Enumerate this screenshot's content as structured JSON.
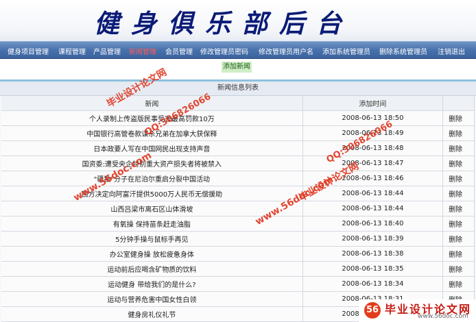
{
  "header": {
    "title": "健身俱乐部后台"
  },
  "nav": {
    "items": [
      {
        "label": "健身项目管理"
      },
      {
        "label": "课程管理"
      },
      {
        "label": "产品管理"
      },
      {
        "label": "新闻管理"
      },
      {
        "label": "会员管理"
      },
      {
        "label": "修改管理员密码"
      },
      {
        "label": "修改管理员用户名"
      },
      {
        "label": "添加系统管理员"
      },
      {
        "label": "删除系统管理员"
      },
      {
        "label": "注销退出"
      }
    ]
  },
  "actions": {
    "add_news": "添加新闻"
  },
  "table": {
    "caption": "新闻信息列表",
    "headers": {
      "title": "新闻",
      "time": "添加时间",
      "op": ""
    },
    "rows": [
      {
        "title": "个人录制上传盗版民事受害最高罚款10万",
        "time": "2008-06-13 18:50",
        "action": "删除"
      },
      {
        "title": "中国银行高管卷款谋杀兄弟在加拿大获保释",
        "time": "2008-06-13 18:49",
        "action": "删除"
      },
      {
        "title": "日本政要人写在中国网民出现支持声音",
        "time": "2008-06-13 18:48",
        "action": "删除"
      },
      {
        "title": "国资委:遭受央企特别重大资产损失者将被禁入",
        "time": "2008-06-13 18:47",
        "action": "删除"
      },
      {
        "title": "\"疆独\"分子在尼泊尔重启分裂中国活动",
        "time": "2008-06-13 18:46",
        "action": "删除"
      },
      {
        "title": "西方决定向阿富汗提供5000万人民币无偿援助",
        "time": "2008-06-13 18:44",
        "action": "删除"
      },
      {
        "title": "山西吕梁市离石区山体滑坡",
        "time": "2008-06-13 18:44",
        "action": "删除"
      },
      {
        "title": "有氧操 保持苗条赶走油脂",
        "time": "2008-06-13 18:40",
        "action": "删除"
      },
      {
        "title": "5分钟手操与鼠标手再见",
        "time": "2008-06-13 18:39",
        "action": "删除"
      },
      {
        "title": "办公室健身操 放松疲惫身体",
        "time": "2008-06-13 18:38",
        "action": "删除"
      },
      {
        "title": "运动前后应喝含矿物质的饮料",
        "time": "2008-06-13 18:35",
        "action": "删除"
      },
      {
        "title": "运动健身 带给我们的是什么?",
        "time": "2008-06-13 18:34",
        "action": "删除"
      },
      {
        "title": "运动与营养危害中国女性白领",
        "time": "2008-06-13 18:31",
        "action": "删除"
      },
      {
        "title": "健身房礼仪礼节",
        "time": "2008-06-13 18:30",
        "action": "删除"
      }
    ]
  },
  "watermarks": {
    "site": "www.56doc.com",
    "qq": "QQ:306826066",
    "brand": "毕业设计论文网",
    "logo_mark": "56",
    "logo_title": "毕业设计论文网",
    "logo_url": "www.56doc.com"
  },
  "colors": {
    "nav_bg": "#4872ad",
    "title": "#0b1b77",
    "active_nav": "#ff5a5a",
    "watermark": "#e0341c"
  }
}
